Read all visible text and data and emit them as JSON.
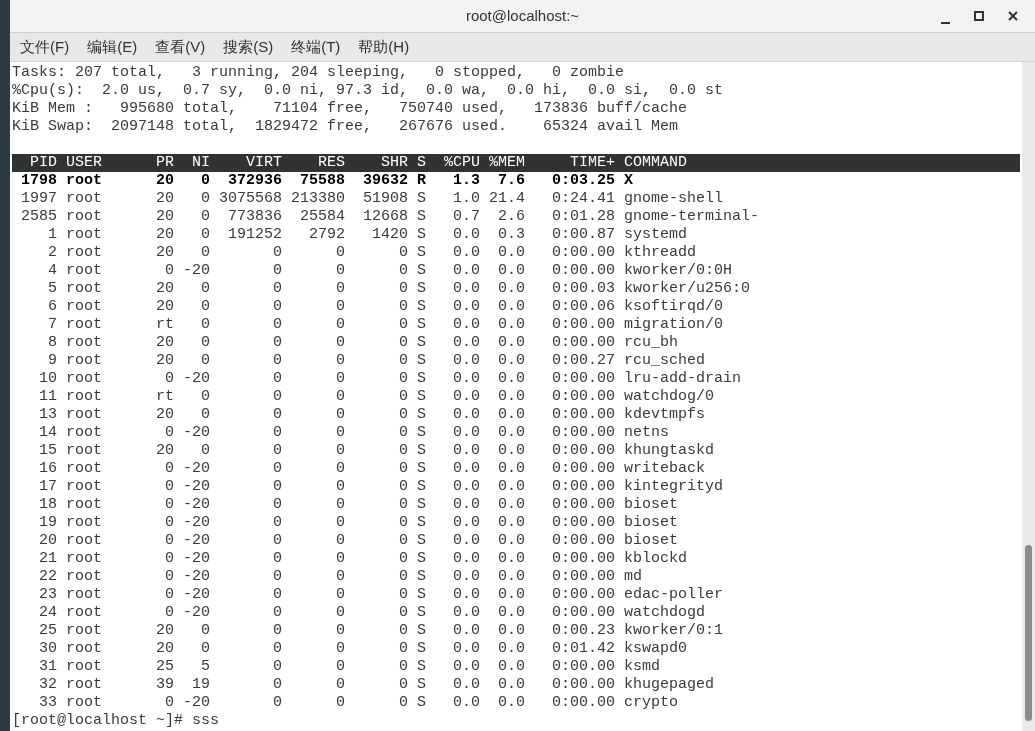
{
  "window": {
    "title": "root@localhost:~"
  },
  "menu": [
    "文件(F)",
    "编辑(E)",
    "查看(V)",
    "搜索(S)",
    "终端(T)",
    "帮助(H)"
  ],
  "summary_lines": [
    "Tasks: 207 total,   3 running, 204 sleeping,   0 stopped,   0 zombie",
    "%Cpu(s):  2.0 us,  0.7 sy,  0.0 ni, 97.3 id,  0.0 wa,  0.0 hi,  0.0 si,  0.0 st",
    "KiB Mem :   995680 total,    71104 free,   750740 used,   173836 buff/cache",
    "KiB Swap:  2097148 total,  1829472 free,   267676 used.    65324 avail Mem"
  ],
  "table": {
    "columns": [
      "PID",
      "USER",
      "PR",
      "NI",
      "VIRT",
      "RES",
      "SHR",
      "S",
      "%CPU",
      "%MEM",
      "TIME+",
      "COMMAND"
    ],
    "rows": [
      {
        "bold": true,
        "cells": [
          "1798",
          "root",
          "20",
          "0",
          "372936",
          "75588",
          "39632",
          "R",
          "1.3",
          "7.6",
          "0:03.25",
          "X"
        ]
      },
      {
        "bold": false,
        "cells": [
          "1997",
          "root",
          "20",
          "0",
          "3075568",
          "213380",
          "51908",
          "S",
          "1.0",
          "21.4",
          "0:24.41",
          "gnome-shell"
        ]
      },
      {
        "bold": false,
        "cells": [
          "2585",
          "root",
          "20",
          "0",
          "773836",
          "25584",
          "12668",
          "S",
          "0.7",
          "2.6",
          "0:01.28",
          "gnome-terminal-"
        ]
      },
      {
        "bold": false,
        "cells": [
          "1",
          "root",
          "20",
          "0",
          "191252",
          "2792",
          "1420",
          "S",
          "0.0",
          "0.3",
          "0:00.87",
          "systemd"
        ]
      },
      {
        "bold": false,
        "cells": [
          "2",
          "root",
          "20",
          "0",
          "0",
          "0",
          "0",
          "S",
          "0.0",
          "0.0",
          "0:00.00",
          "kthreadd"
        ]
      },
      {
        "bold": false,
        "cells": [
          "4",
          "root",
          "0",
          "-20",
          "0",
          "0",
          "0",
          "S",
          "0.0",
          "0.0",
          "0:00.00",
          "kworker/0:0H"
        ]
      },
      {
        "bold": false,
        "cells": [
          "5",
          "root",
          "20",
          "0",
          "0",
          "0",
          "0",
          "S",
          "0.0",
          "0.0",
          "0:00.03",
          "kworker/u256:0"
        ]
      },
      {
        "bold": false,
        "cells": [
          "6",
          "root",
          "20",
          "0",
          "0",
          "0",
          "0",
          "S",
          "0.0",
          "0.0",
          "0:00.06",
          "ksoftirqd/0"
        ]
      },
      {
        "bold": false,
        "cells": [
          "7",
          "root",
          "rt",
          "0",
          "0",
          "0",
          "0",
          "S",
          "0.0",
          "0.0",
          "0:00.00",
          "migration/0"
        ]
      },
      {
        "bold": false,
        "cells": [
          "8",
          "root",
          "20",
          "0",
          "0",
          "0",
          "0",
          "S",
          "0.0",
          "0.0",
          "0:00.00",
          "rcu_bh"
        ]
      },
      {
        "bold": false,
        "cells": [
          "9",
          "root",
          "20",
          "0",
          "0",
          "0",
          "0",
          "S",
          "0.0",
          "0.0",
          "0:00.27",
          "rcu_sched"
        ]
      },
      {
        "bold": false,
        "cells": [
          "10",
          "root",
          "0",
          "-20",
          "0",
          "0",
          "0",
          "S",
          "0.0",
          "0.0",
          "0:00.00",
          "lru-add-drain"
        ]
      },
      {
        "bold": false,
        "cells": [
          "11",
          "root",
          "rt",
          "0",
          "0",
          "0",
          "0",
          "S",
          "0.0",
          "0.0",
          "0:00.00",
          "watchdog/0"
        ]
      },
      {
        "bold": false,
        "cells": [
          "13",
          "root",
          "20",
          "0",
          "0",
          "0",
          "0",
          "S",
          "0.0",
          "0.0",
          "0:00.00",
          "kdevtmpfs"
        ]
      },
      {
        "bold": false,
        "cells": [
          "14",
          "root",
          "0",
          "-20",
          "0",
          "0",
          "0",
          "S",
          "0.0",
          "0.0",
          "0:00.00",
          "netns"
        ]
      },
      {
        "bold": false,
        "cells": [
          "15",
          "root",
          "20",
          "0",
          "0",
          "0",
          "0",
          "S",
          "0.0",
          "0.0",
          "0:00.00",
          "khungtaskd"
        ]
      },
      {
        "bold": false,
        "cells": [
          "16",
          "root",
          "0",
          "-20",
          "0",
          "0",
          "0",
          "S",
          "0.0",
          "0.0",
          "0:00.00",
          "writeback"
        ]
      },
      {
        "bold": false,
        "cells": [
          "17",
          "root",
          "0",
          "-20",
          "0",
          "0",
          "0",
          "S",
          "0.0",
          "0.0",
          "0:00.00",
          "kintegrityd"
        ]
      },
      {
        "bold": false,
        "cells": [
          "18",
          "root",
          "0",
          "-20",
          "0",
          "0",
          "0",
          "S",
          "0.0",
          "0.0",
          "0:00.00",
          "bioset"
        ]
      },
      {
        "bold": false,
        "cells": [
          "19",
          "root",
          "0",
          "-20",
          "0",
          "0",
          "0",
          "S",
          "0.0",
          "0.0",
          "0:00.00",
          "bioset"
        ]
      },
      {
        "bold": false,
        "cells": [
          "20",
          "root",
          "0",
          "-20",
          "0",
          "0",
          "0",
          "S",
          "0.0",
          "0.0",
          "0:00.00",
          "bioset"
        ]
      },
      {
        "bold": false,
        "cells": [
          "21",
          "root",
          "0",
          "-20",
          "0",
          "0",
          "0",
          "S",
          "0.0",
          "0.0",
          "0:00.00",
          "kblockd"
        ]
      },
      {
        "bold": false,
        "cells": [
          "22",
          "root",
          "0",
          "-20",
          "0",
          "0",
          "0",
          "S",
          "0.0",
          "0.0",
          "0:00.00",
          "md"
        ]
      },
      {
        "bold": false,
        "cells": [
          "23",
          "root",
          "0",
          "-20",
          "0",
          "0",
          "0",
          "S",
          "0.0",
          "0.0",
          "0:00.00",
          "edac-poller"
        ]
      },
      {
        "bold": false,
        "cells": [
          "24",
          "root",
          "0",
          "-20",
          "0",
          "0",
          "0",
          "S",
          "0.0",
          "0.0",
          "0:00.00",
          "watchdogd"
        ]
      },
      {
        "bold": false,
        "cells": [
          "25",
          "root",
          "20",
          "0",
          "0",
          "0",
          "0",
          "S",
          "0.0",
          "0.0",
          "0:00.23",
          "kworker/0:1"
        ]
      },
      {
        "bold": false,
        "cells": [
          "30",
          "root",
          "20",
          "0",
          "0",
          "0",
          "0",
          "S",
          "0.0",
          "0.0",
          "0:01.42",
          "kswapd0"
        ]
      },
      {
        "bold": false,
        "cells": [
          "31",
          "root",
          "25",
          "5",
          "0",
          "0",
          "0",
          "S",
          "0.0",
          "0.0",
          "0:00.00",
          "ksmd"
        ]
      },
      {
        "bold": false,
        "cells": [
          "32",
          "root",
          "39",
          "19",
          "0",
          "0",
          "0",
          "S",
          "0.0",
          "0.0",
          "0:00.00",
          "khugepaged"
        ]
      },
      {
        "bold": false,
        "cells": [
          "33",
          "root",
          "0",
          "-20",
          "0",
          "0",
          "0",
          "S",
          "0.0",
          "0.0",
          "0:00.00",
          "crypto"
        ]
      }
    ]
  },
  "prompt": "[root@localhost ~]# sss"
}
